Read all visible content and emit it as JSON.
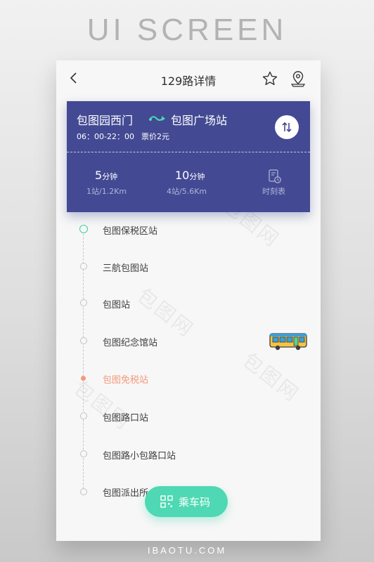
{
  "banner": {
    "title": "UI SCREEN"
  },
  "footer": {
    "site": "IBAOTU.COM"
  },
  "nav": {
    "title": "129路详情"
  },
  "route": {
    "from": "包图园西门",
    "to": "包图广场站",
    "hours": "06：00-22：00",
    "fare": "票价2元"
  },
  "stats": [
    {
      "value": "5",
      "unit": "分钟",
      "detail": "1站/1.2Km"
    },
    {
      "value": "10",
      "unit": "分钟",
      "detail": "4站/5.6Km"
    }
  ],
  "timetable": {
    "label": "时刻表"
  },
  "stops": [
    {
      "name": "包图保税区站",
      "state": "current"
    },
    {
      "name": "三航包图站",
      "state": "normal"
    },
    {
      "name": "包图站",
      "state": "normal"
    },
    {
      "name": "包图纪念馆站",
      "state": "normal"
    },
    {
      "name": "包图免税站",
      "state": "alert"
    },
    {
      "name": "包图路口站",
      "state": "normal"
    },
    {
      "name": "包图路小包路口站",
      "state": "normal"
    },
    {
      "name": "包图派出所",
      "state": "normal"
    }
  ],
  "ride_button": {
    "label": "乘车码"
  },
  "watermark": "包图网",
  "colors": {
    "card": "#434a93",
    "accent_green": "#4ed8b3",
    "alert_orange": "#f39a7a"
  },
  "icons": [
    "back-arrow-icon",
    "star-icon",
    "location-pin-icon",
    "route-arrow-icon",
    "swap-icon",
    "timetable-icon",
    "bus-icon",
    "qr-code-icon"
  ]
}
